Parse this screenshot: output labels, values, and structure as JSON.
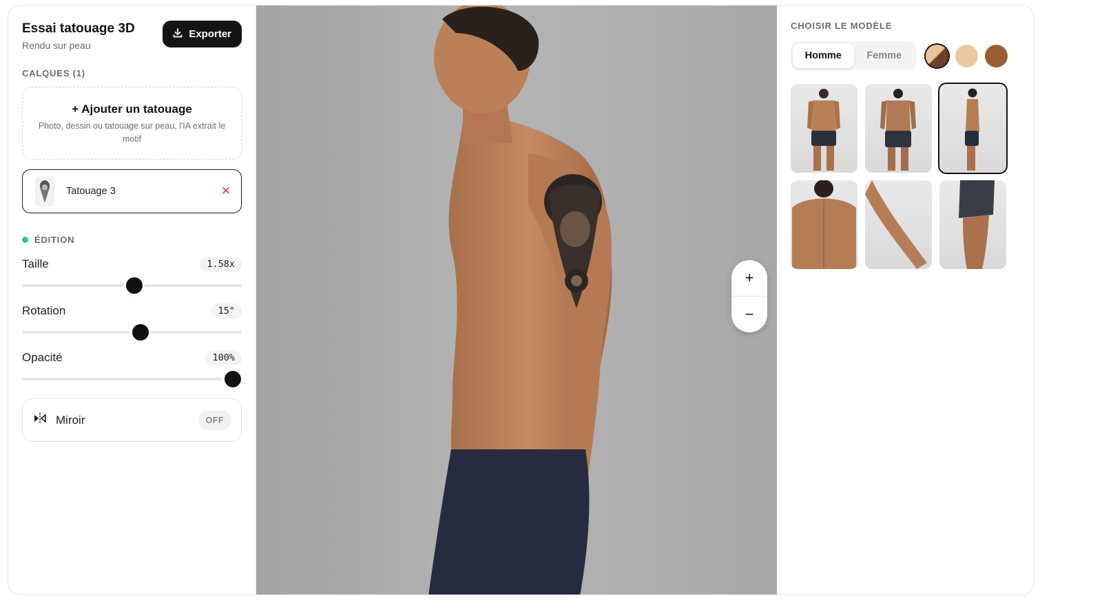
{
  "header": {
    "title": "Essai tatouage 3D",
    "subtitle": "Rendu sur peau",
    "export_label": "Exporter"
  },
  "layers": {
    "label": "CALQUES (1)",
    "add_title": "+ Ajouter un tatouage",
    "add_description": "Photo, dessin ou tatouage sur peau, l'IA extrait le motif",
    "items": [
      {
        "name": "Tatouage 3"
      }
    ]
  },
  "edition": {
    "label": "ÉDITION",
    "status_color": "#2ec48c",
    "controls": [
      {
        "name": "Taille",
        "value": "1.58x",
        "fraction": 0.51
      },
      {
        "name": "Rotation",
        "value": "15°",
        "fraction": 0.54
      },
      {
        "name": "Opacité",
        "value": "100%",
        "fraction": 0.96
      }
    ],
    "mirror": {
      "label": "Miroir",
      "state": "OFF"
    }
  },
  "canvas": {
    "zoom_in": "+",
    "zoom_out": "−"
  },
  "models": {
    "label": "CHOISIR LE MODÈLE",
    "genders": [
      "Homme",
      "Femme"
    ],
    "selected_gender": "Homme",
    "skin_tones": [
      "#c89a72",
      "#ecc9a0",
      "#9a5c34"
    ],
    "selected_tone": 0,
    "thumbnails": [
      "front",
      "back",
      "side",
      "upper-back",
      "forearm",
      "leg-side"
    ],
    "selected_thumbnail": 2
  }
}
